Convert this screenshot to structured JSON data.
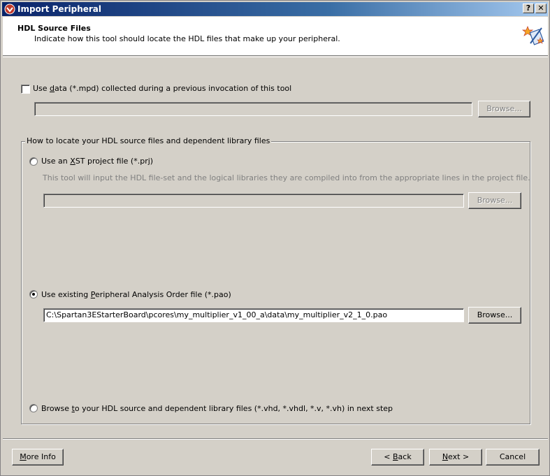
{
  "window": {
    "title": "Import Peripheral",
    "help_button": "?",
    "close_button": "✕"
  },
  "header": {
    "title": "HDL Source Files",
    "subtitle": "Indicate how this tool should locate the HDL files that make up your peripheral."
  },
  "use_data": {
    "label_pre": "Use ",
    "label_mnemonic": "d",
    "label_post": "ata (*.mpd) collected during a previous invocation of this tool",
    "checked": false,
    "path_value": "",
    "browse_label": "Browse..."
  },
  "group": {
    "legend": "How to locate your HDL source files and dependent library files",
    "options": [
      {
        "label_pre": "Use an ",
        "label_mnemonic": "X",
        "label_post": "ST project file (*.prj)",
        "selected": false,
        "description": "This tool will input the HDL file-set and the logical libraries they are compiled into from the appropriate lines in the project file.",
        "path_value": "",
        "browse_label": "Browse..."
      },
      {
        "label_pre": "Use existing ",
        "label_mnemonic": "P",
        "label_post": "eripheral Analysis Order file (*.pao)",
        "selected": true,
        "path_value": "C:\\Spartan3EStarterBoard\\pcores\\my_multiplier_v1_00_a\\data\\my_multiplier_v2_1_0.pao",
        "browse_label": "Browse..."
      },
      {
        "label_pre": "Browse ",
        "label_mnemonic": "t",
        "label_post": "o your HDL source and dependent library files (*.vhd, *.vhdl, *.v, *.vh) in next step",
        "selected": false
      }
    ]
  },
  "footer": {
    "more_info": "More Info",
    "back": "< Back",
    "next": "Next >",
    "cancel": "Cancel"
  },
  "colors": {
    "face": "#d4d0c8",
    "titlebar_start": "#0a246a",
    "titlebar_end": "#a6caf0"
  },
  "icons": {
    "app": "import-peripheral-app-icon",
    "wizard": "wizard-magic-wand-icon"
  }
}
